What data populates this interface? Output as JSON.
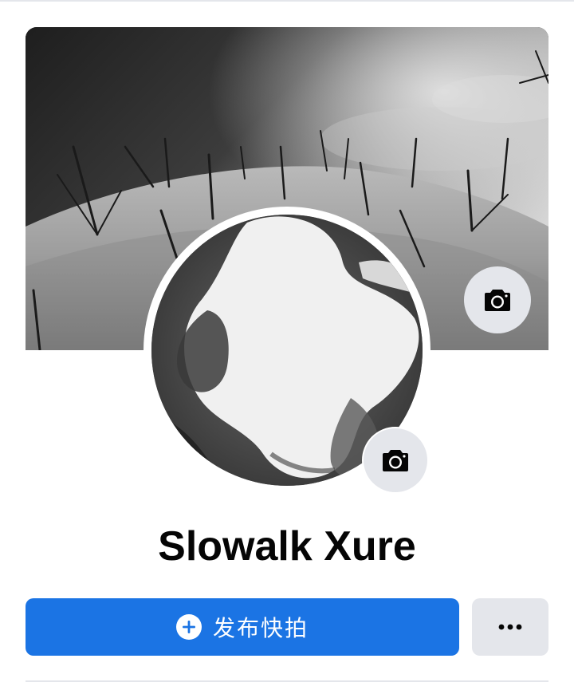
{
  "profile": {
    "name": "Slowalk Xure"
  },
  "actions": {
    "primary_label": "发布快拍",
    "primary_icon": "plus-circle-icon",
    "more_icon": "more-horizontal-icon"
  },
  "icons": {
    "cover_camera": "camera-icon",
    "avatar_camera": "camera-icon"
  },
  "colors": {
    "primary": "#1b74e4",
    "secondary_button": "#e4e6eb",
    "text": "#050505"
  }
}
